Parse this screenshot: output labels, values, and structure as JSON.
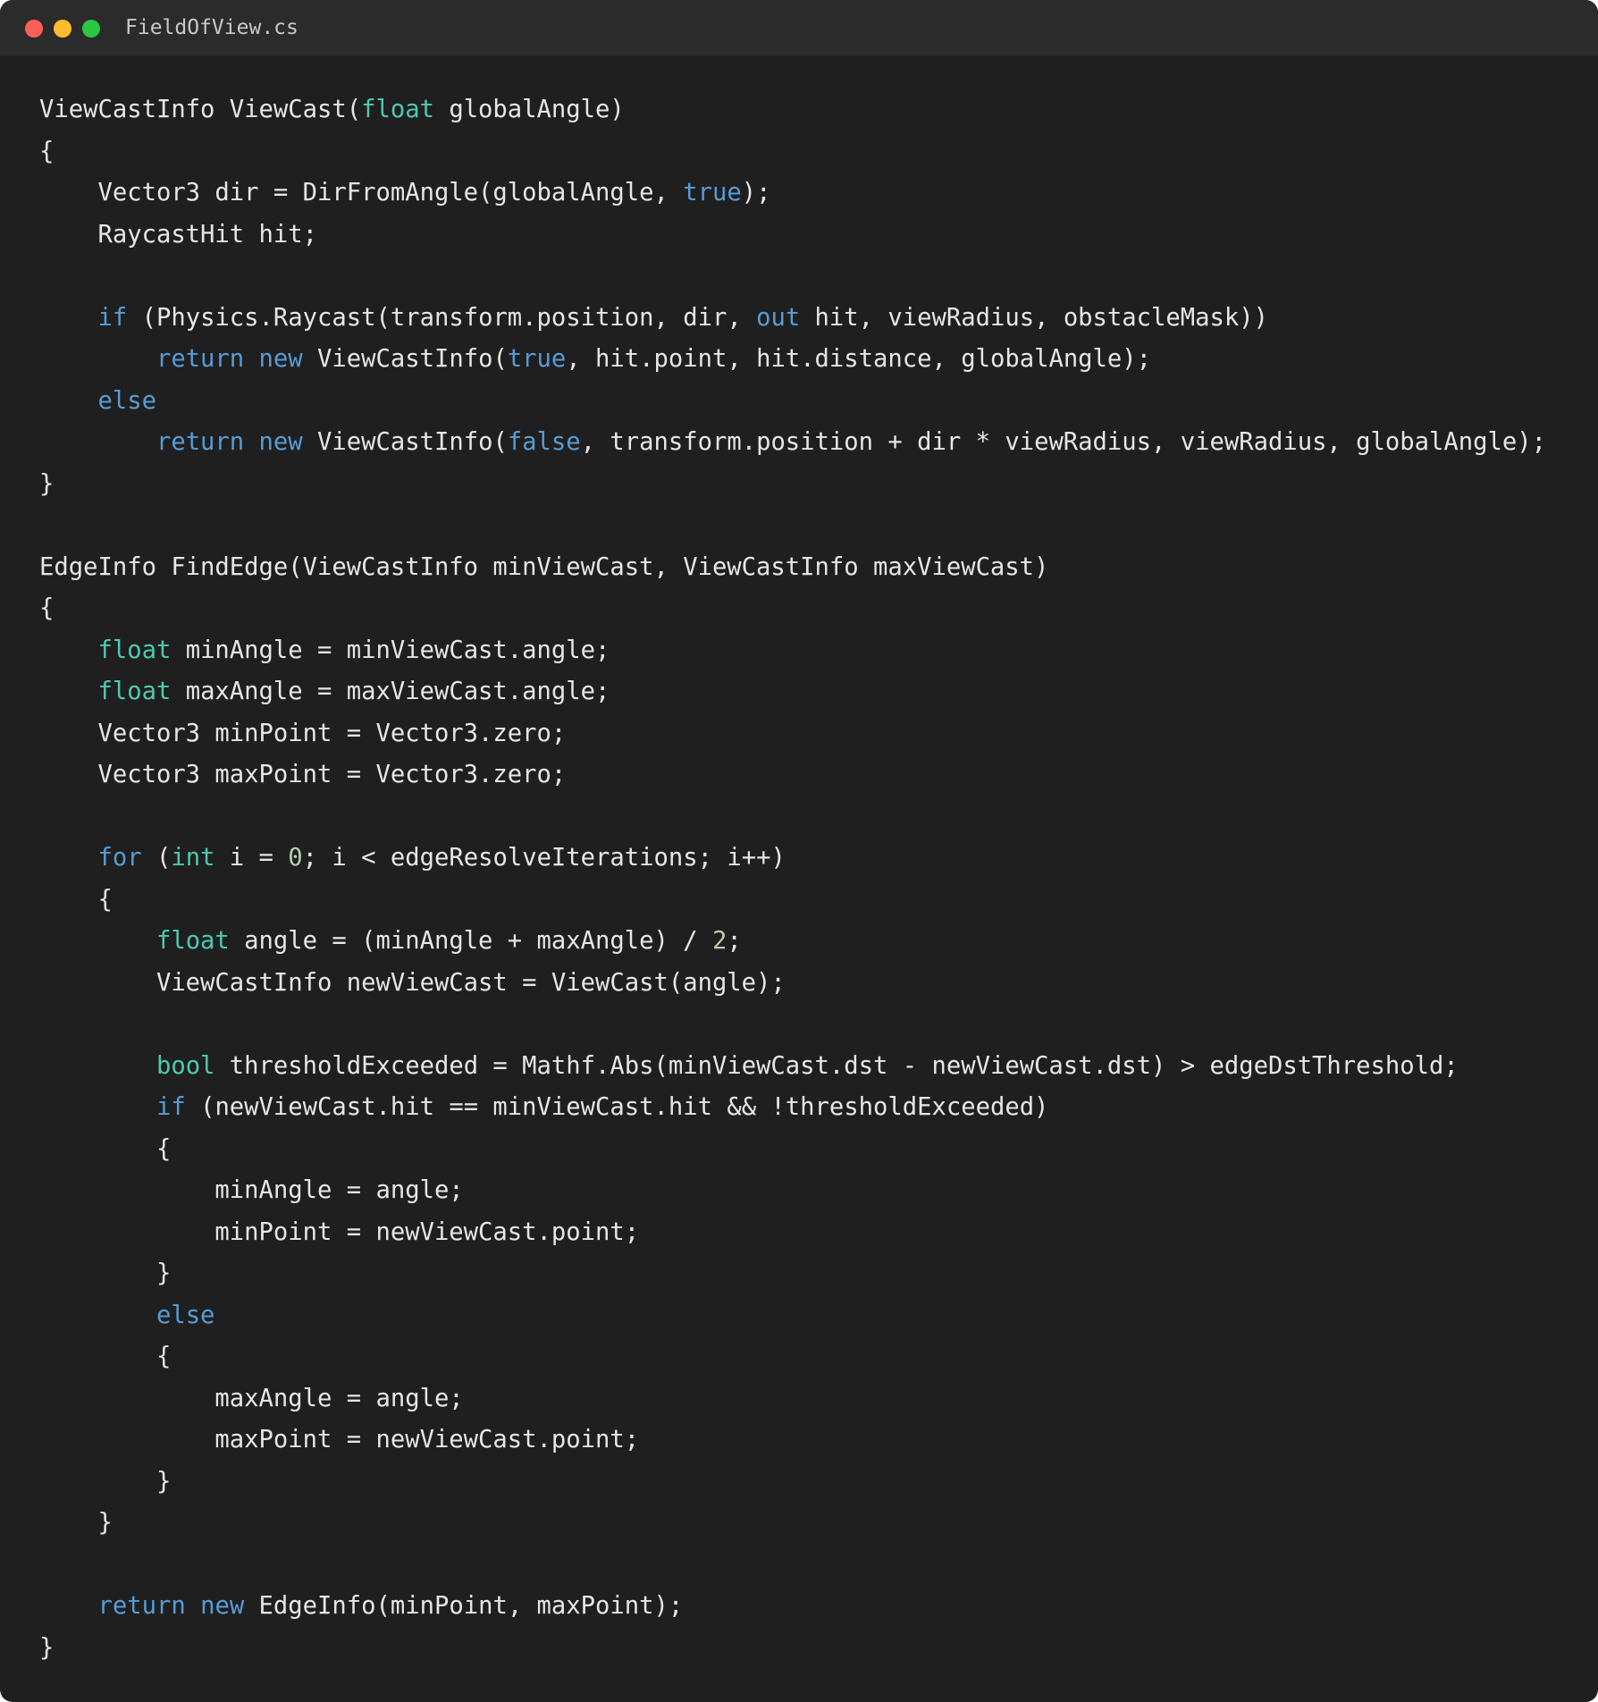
{
  "window": {
    "filename": "FieldOfView.cs",
    "traffic_lights": [
      {
        "name": "close",
        "color": "#ff5f57"
      },
      {
        "name": "minimize",
        "color": "#febc2e"
      },
      {
        "name": "maximize",
        "color": "#28c840"
      }
    ]
  },
  "colors": {
    "background": "#1f1f1f",
    "titlebar": "#2b2b2b",
    "plain": "#e6e6e6",
    "type_keyword": "#4ec9b0",
    "control_keyword": "#569cd6",
    "number": "#b5cea8"
  },
  "code_lines": [
    [
      [
        "plain",
        "ViewCastInfo ViewCast("
      ],
      [
        "type",
        "float"
      ],
      [
        "plain",
        " globalAngle)"
      ]
    ],
    [
      [
        "plain",
        "{"
      ]
    ],
    [
      [
        "plain",
        "    Vector3 dir = DirFromAngle(globalAngle, "
      ],
      [
        "keyword",
        "true"
      ],
      [
        "plain",
        ");"
      ]
    ],
    [
      [
        "plain",
        "    RaycastHit hit;"
      ]
    ],
    [],
    [
      [
        "plain",
        "    "
      ],
      [
        "keyword",
        "if"
      ],
      [
        "plain",
        " (Physics.Raycast(transform.position, dir, "
      ],
      [
        "keyword",
        "out"
      ],
      [
        "plain",
        " hit, viewRadius, obstacleMask))"
      ]
    ],
    [
      [
        "plain",
        "        "
      ],
      [
        "keyword",
        "return"
      ],
      [
        "plain",
        " "
      ],
      [
        "keyword",
        "new"
      ],
      [
        "plain",
        " ViewCastInfo("
      ],
      [
        "keyword",
        "true"
      ],
      [
        "plain",
        ", hit.point, hit.distance, globalAngle);"
      ]
    ],
    [
      [
        "plain",
        "    "
      ],
      [
        "keyword",
        "else"
      ]
    ],
    [
      [
        "plain",
        "        "
      ],
      [
        "keyword",
        "return"
      ],
      [
        "plain",
        " "
      ],
      [
        "keyword",
        "new"
      ],
      [
        "plain",
        " ViewCastInfo("
      ],
      [
        "keyword",
        "false"
      ],
      [
        "plain",
        ", transform.position + dir * viewRadius, viewRadius, globalAngle);"
      ]
    ],
    [
      [
        "plain",
        "}"
      ]
    ],
    [],
    [
      [
        "plain",
        "EdgeInfo FindEdge(ViewCastInfo minViewCast, ViewCastInfo maxViewCast)"
      ]
    ],
    [
      [
        "plain",
        "{"
      ]
    ],
    [
      [
        "plain",
        "    "
      ],
      [
        "type",
        "float"
      ],
      [
        "plain",
        " minAngle = minViewCast.angle;"
      ]
    ],
    [
      [
        "plain",
        "    "
      ],
      [
        "type",
        "float"
      ],
      [
        "plain",
        " maxAngle = maxViewCast.angle;"
      ]
    ],
    [
      [
        "plain",
        "    Vector3 minPoint = Vector3.zero;"
      ]
    ],
    [
      [
        "plain",
        "    Vector3 maxPoint = Vector3.zero;"
      ]
    ],
    [],
    [
      [
        "plain",
        "    "
      ],
      [
        "keyword",
        "for"
      ],
      [
        "plain",
        " ("
      ],
      [
        "type",
        "int"
      ],
      [
        "plain",
        " i = "
      ],
      [
        "number",
        "0"
      ],
      [
        "plain",
        "; i < edgeResolveIterations; i++)"
      ]
    ],
    [
      [
        "plain",
        "    {"
      ]
    ],
    [
      [
        "plain",
        "        "
      ],
      [
        "type",
        "float"
      ],
      [
        "plain",
        " angle = (minAngle + maxAngle) / "
      ],
      [
        "number",
        "2"
      ],
      [
        "plain",
        ";"
      ]
    ],
    [
      [
        "plain",
        "        ViewCastInfo newViewCast = ViewCast(angle);"
      ]
    ],
    [],
    [
      [
        "plain",
        "        "
      ],
      [
        "type",
        "bool"
      ],
      [
        "plain",
        " thresholdExceeded = Mathf.Abs(minViewCast.dst - newViewCast.dst) > edgeDstThreshold;"
      ]
    ],
    [
      [
        "plain",
        "        "
      ],
      [
        "keyword",
        "if"
      ],
      [
        "plain",
        " (newViewCast.hit == minViewCast.hit && !thresholdExceeded)"
      ]
    ],
    [
      [
        "plain",
        "        {"
      ]
    ],
    [
      [
        "plain",
        "            minAngle = angle;"
      ]
    ],
    [
      [
        "plain",
        "            minPoint = newViewCast.point;"
      ]
    ],
    [
      [
        "plain",
        "        }"
      ]
    ],
    [
      [
        "plain",
        "        "
      ],
      [
        "keyword",
        "else"
      ]
    ],
    [
      [
        "plain",
        "        {"
      ]
    ],
    [
      [
        "plain",
        "            maxAngle = angle;"
      ]
    ],
    [
      [
        "plain",
        "            maxPoint = newViewCast.point;"
      ]
    ],
    [
      [
        "plain",
        "        }"
      ]
    ],
    [
      [
        "plain",
        "    }"
      ]
    ],
    [],
    [
      [
        "plain",
        "    "
      ],
      [
        "keyword",
        "return"
      ],
      [
        "plain",
        " "
      ],
      [
        "keyword",
        "new"
      ],
      [
        "plain",
        " EdgeInfo(minPoint, maxPoint);"
      ]
    ],
    [
      [
        "plain",
        "}"
      ]
    ]
  ]
}
